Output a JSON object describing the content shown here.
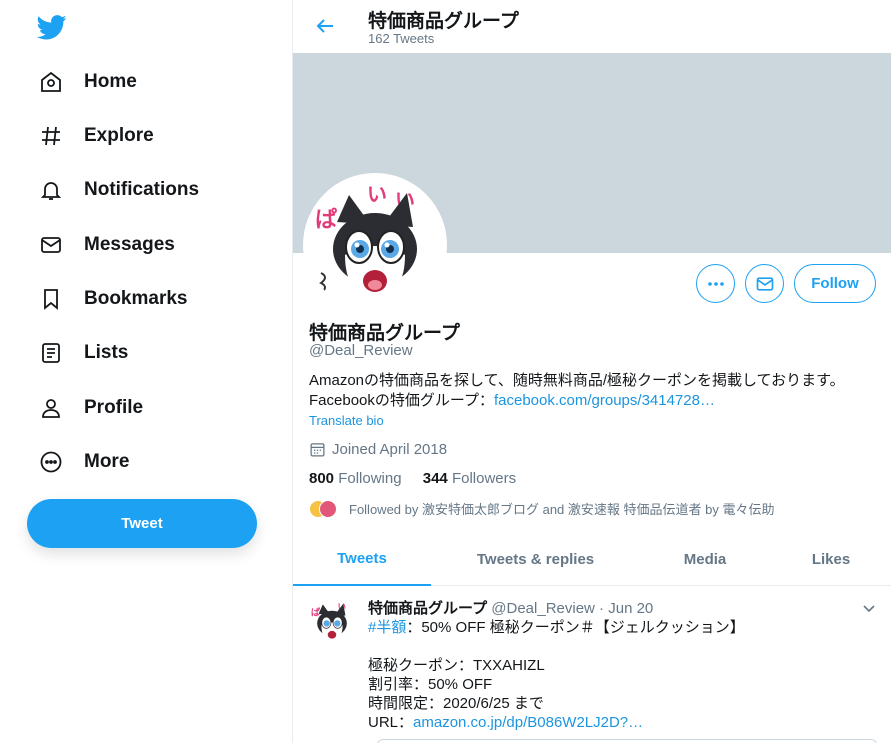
{
  "nav": {
    "items": [
      {
        "label": "Home",
        "icon": "home-icon"
      },
      {
        "label": "Explore",
        "icon": "hashtag-icon"
      },
      {
        "label": "Notifications",
        "icon": "bell-icon"
      },
      {
        "label": "Messages",
        "icon": "envelope-icon"
      },
      {
        "label": "Bookmarks",
        "icon": "bookmark-icon"
      },
      {
        "label": "Lists",
        "icon": "list-icon"
      },
      {
        "label": "Profile",
        "icon": "person-icon"
      },
      {
        "label": "More",
        "icon": "more-circle-icon"
      }
    ],
    "tweet_button": "Tweet"
  },
  "header": {
    "title": "特価商品グループ",
    "subtitle": "162 Tweets"
  },
  "profile": {
    "name": "特価商品グループ",
    "handle": "@Deal_Review",
    "bio_line1": "Amazonの特価商品を探して、随時無料商品/極秘クーポンを掲載しております。",
    "bio_line2_prefix": "Facebookの特価グループ：",
    "bio_link": "facebook.com/groups/3414728…",
    "translate": "Translate bio",
    "joined": "Joined April 2018",
    "following_count": "800",
    "following_label": "Following",
    "followers_count": "344",
    "followers_label": "Followers",
    "followed_by": "Followed by 激安特価太郎ブログ and 激安速報 特価品伝道者 by 電々伝助",
    "follow_button": "Follow"
  },
  "tabs": [
    "Tweets",
    "Tweets & replies",
    "Media",
    "Likes"
  ],
  "tweet": {
    "name": "特価商品グループ",
    "handle": "@Deal_Review",
    "separator": " · ",
    "date": "Jun 20",
    "hashtag": "#半額",
    "line1_rest": "：50% OFF 極秘クーポン＃【ジェルクッション】",
    "line3": "極秘クーポン：TXXAHIZL",
    "line4": "割引率：50% OFF",
    "line5": "時間限定：2020/6/25 まで",
    "line6_prefix": "URL：",
    "line6_link": "amazon.co.jp/dp/B086W2LJ2D?…"
  },
  "colors": {
    "accent": "#1da1f2",
    "banner": "#ccd6dd",
    "secondary_text": "#657786"
  }
}
